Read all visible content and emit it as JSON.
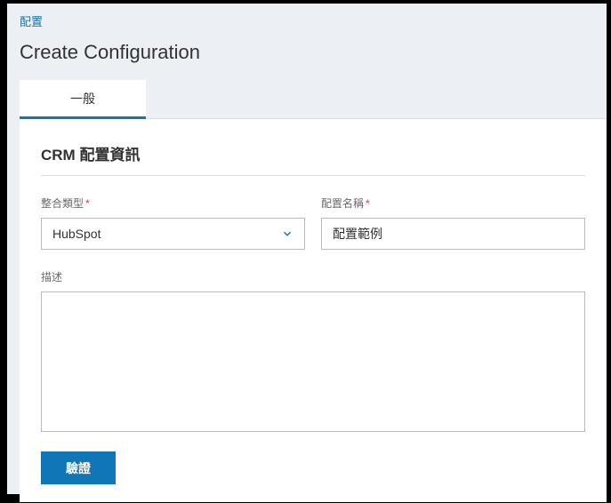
{
  "breadcrumb": {
    "label": "配置"
  },
  "page": {
    "title": "Create Configuration"
  },
  "tabs": {
    "general": "一般"
  },
  "section": {
    "heading": "CRM 配置資訊"
  },
  "fields": {
    "integration_type": {
      "label": "整合類型",
      "value": "HubSpot"
    },
    "config_name": {
      "label": "配置名稱",
      "value": "配置範例"
    },
    "description": {
      "label": "描述",
      "value": ""
    }
  },
  "buttons": {
    "validate": "驗證"
  }
}
